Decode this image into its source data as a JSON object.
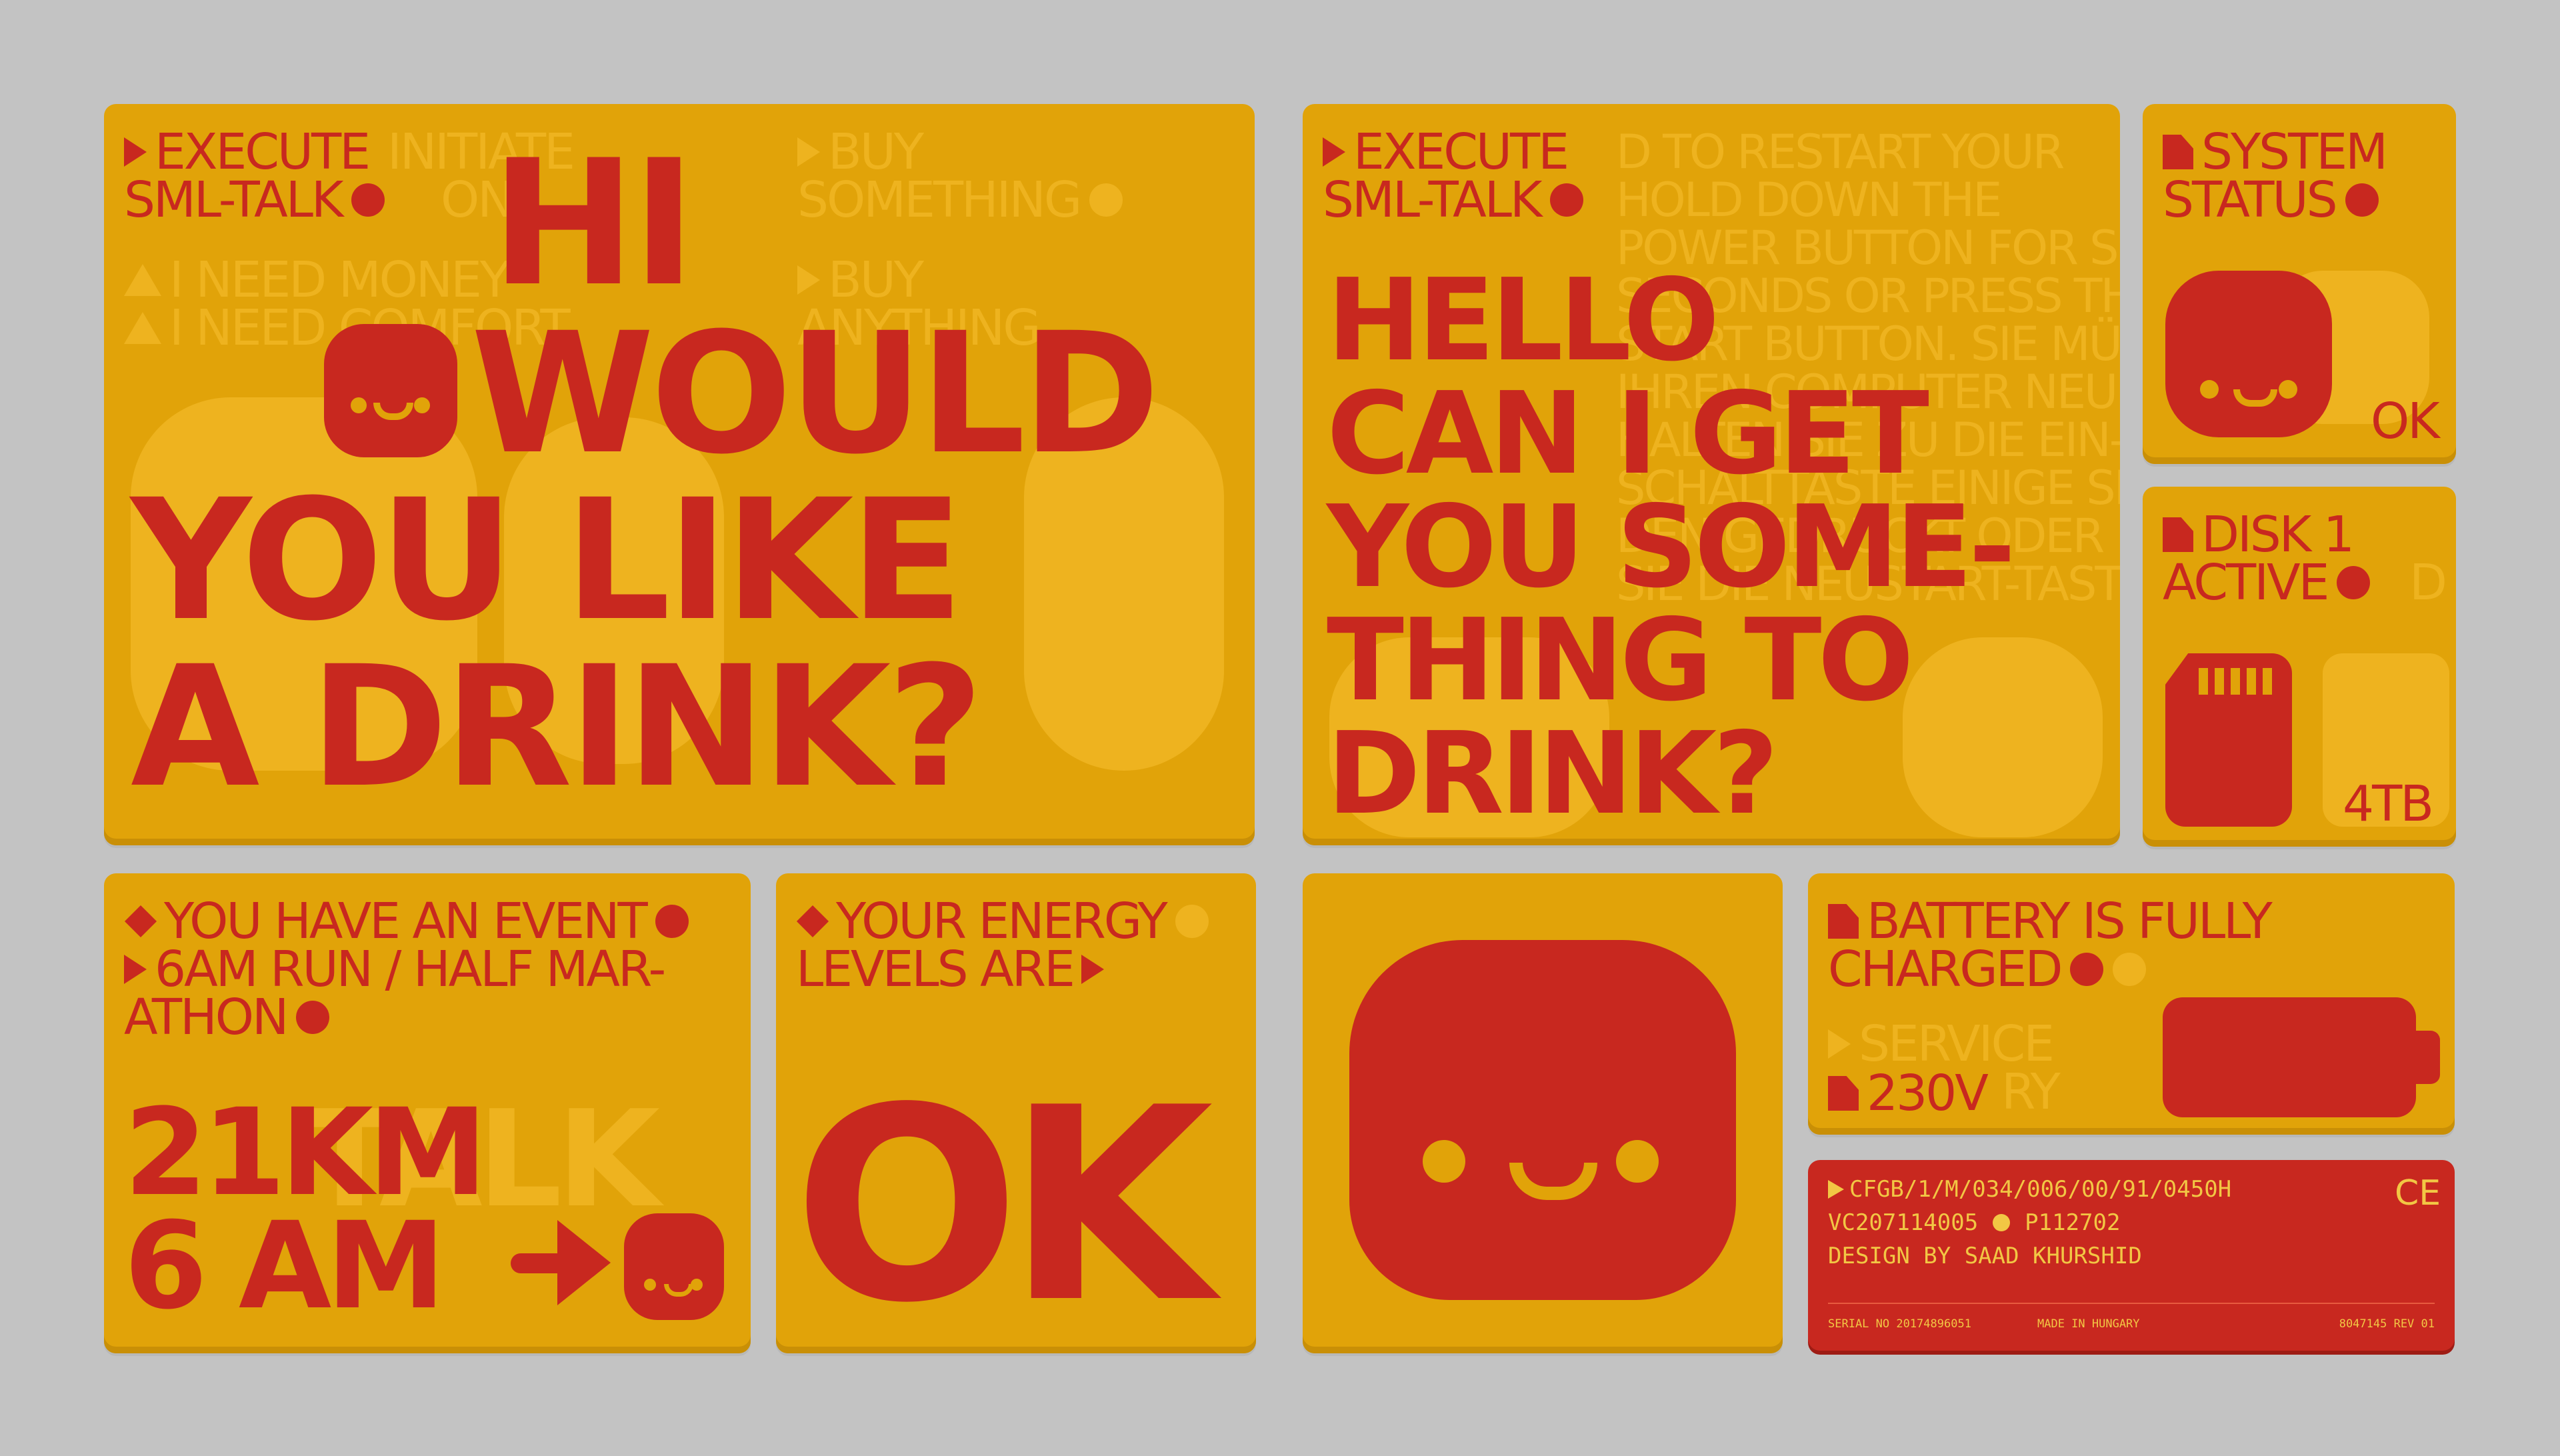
{
  "panel_drink": {
    "cmd1": "EXECUTE",
    "cmd2": "SML-TALK",
    "ghost_a1": "INITIATE",
    "ghost_a2": "ON",
    "ghost_b1": "BUY",
    "ghost_b2": "SOMETHING",
    "ghost_c1": "BUY",
    "ghost_c2": "ANYTHING",
    "ghost_d": "I NEED MONEY",
    "ghost_e": "I NEED COMFORT",
    "line1": "HI",
    "line2": "WOULD",
    "line3": "YOU LIKE",
    "line4": "A DRINK?"
  },
  "panel_hello": {
    "cmd1": "EXECUTE",
    "cmd2": "SML-TALK",
    "ghost_bg": "D TO RESTART YOUR\nHOLD DOWN THE\nPOWER BUTTON FOR SEVERAL\nSECONDS OR PRESS THE RE-\nSTART BUTTON. SIE MÜSSEN\nIHREN COMPUTER NEU STARTEN\nHALTEN SIE ZU DIE EIN-\nSCHALTTASTE EINIGE SEKU\nDEN GEDRÜCKT ODER DRÜCKEN\nSIE DIE NEUSTART-TASTE",
    "line1": "HELLO",
    "line2": "CAN I GET",
    "line3": "YOU SOME-",
    "line4": "THING TO",
    "line5": "DRINK?"
  },
  "panel_system": {
    "title1": "SYSTEM",
    "title2": "STATUS",
    "status": "OK"
  },
  "panel_disk": {
    "title1": "DISK 1",
    "title2": "ACTIVE",
    "ghost": "D",
    "size": "4TB"
  },
  "panel_event": {
    "line1": "YOU HAVE AN EVENT",
    "line2": "6AM RUN / HALF MAR-",
    "line3": "ATHON",
    "ghost": "TALK",
    "big1": "21KM",
    "big2": "6 AM"
  },
  "panel_energy": {
    "line1": "YOUR ENERGY",
    "line2": "LEVELS ARE",
    "value": "OK"
  },
  "panel_battery": {
    "line1": "BATTERY IS FULLY",
    "line2": "CHARGED",
    "ghost1": "SERVICE",
    "ghost2": "RY",
    "voltage": "230V",
    "charge_fraction": 1.0
  },
  "panel_serial": {
    "code": "CFGB/1/M/034/006/00/91/0450H",
    "vc": "VC207114005",
    "p": "P112702",
    "design": "DESIGN BY SAAD KHURSHID",
    "ce": "CE",
    "serial_no": "SERIAL NO 20174896051",
    "made_in": "MADE IN HUNGARY",
    "rev": "8047145 REV 01"
  },
  "colors": {
    "background": "#c3c3c3",
    "panel": "#e1a309",
    "accent": "#c8281f",
    "ghost": "#eeb31f"
  },
  "icons": {
    "arrow": "arrow-right-icon",
    "triangle": "triangle-icon",
    "diamond": "diamond-icon",
    "document": "document-icon",
    "face": "smiley-face-icon",
    "sd_card": "sd-card-icon",
    "battery": "battery-icon"
  }
}
